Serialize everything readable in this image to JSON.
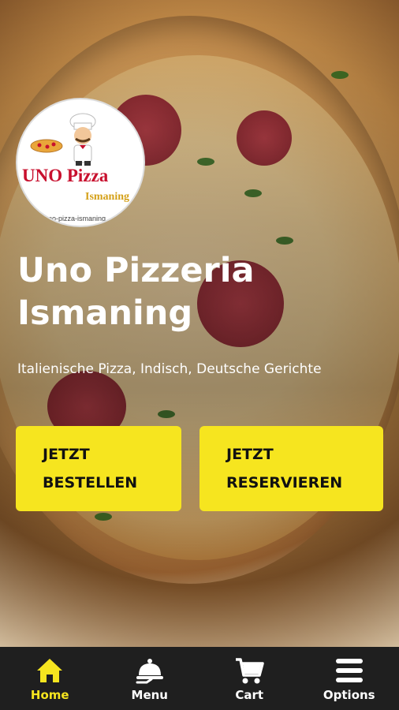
{
  "hero": {
    "title": "Uno Pizzeria Ismaning",
    "subtitle": "Italienische Pizza, Indisch, Deutsche Gerichte"
  },
  "logo": {
    "line1": "UNO Pizza",
    "line2": "Ismaning",
    "line3": "uno-pizza-ismaning"
  },
  "actions": {
    "order": {
      "line1": "JETZT",
      "line2": "BESTELLEN"
    },
    "reserve": {
      "line1": "JETZT",
      "line2": "RESERVIEREN"
    }
  },
  "nav": {
    "items": [
      {
        "label": "Home",
        "icon": "home-icon",
        "active": true
      },
      {
        "label": "Menu",
        "icon": "serving-cloche-icon",
        "active": false
      },
      {
        "label": "Cart",
        "icon": "cart-icon",
        "active": false
      },
      {
        "label": "Options",
        "icon": "menu-bars-icon",
        "active": false
      }
    ]
  },
  "colors": {
    "accent": "#f6e51f",
    "nav_bg": "#1f1f1f",
    "text": "#ffffff"
  }
}
